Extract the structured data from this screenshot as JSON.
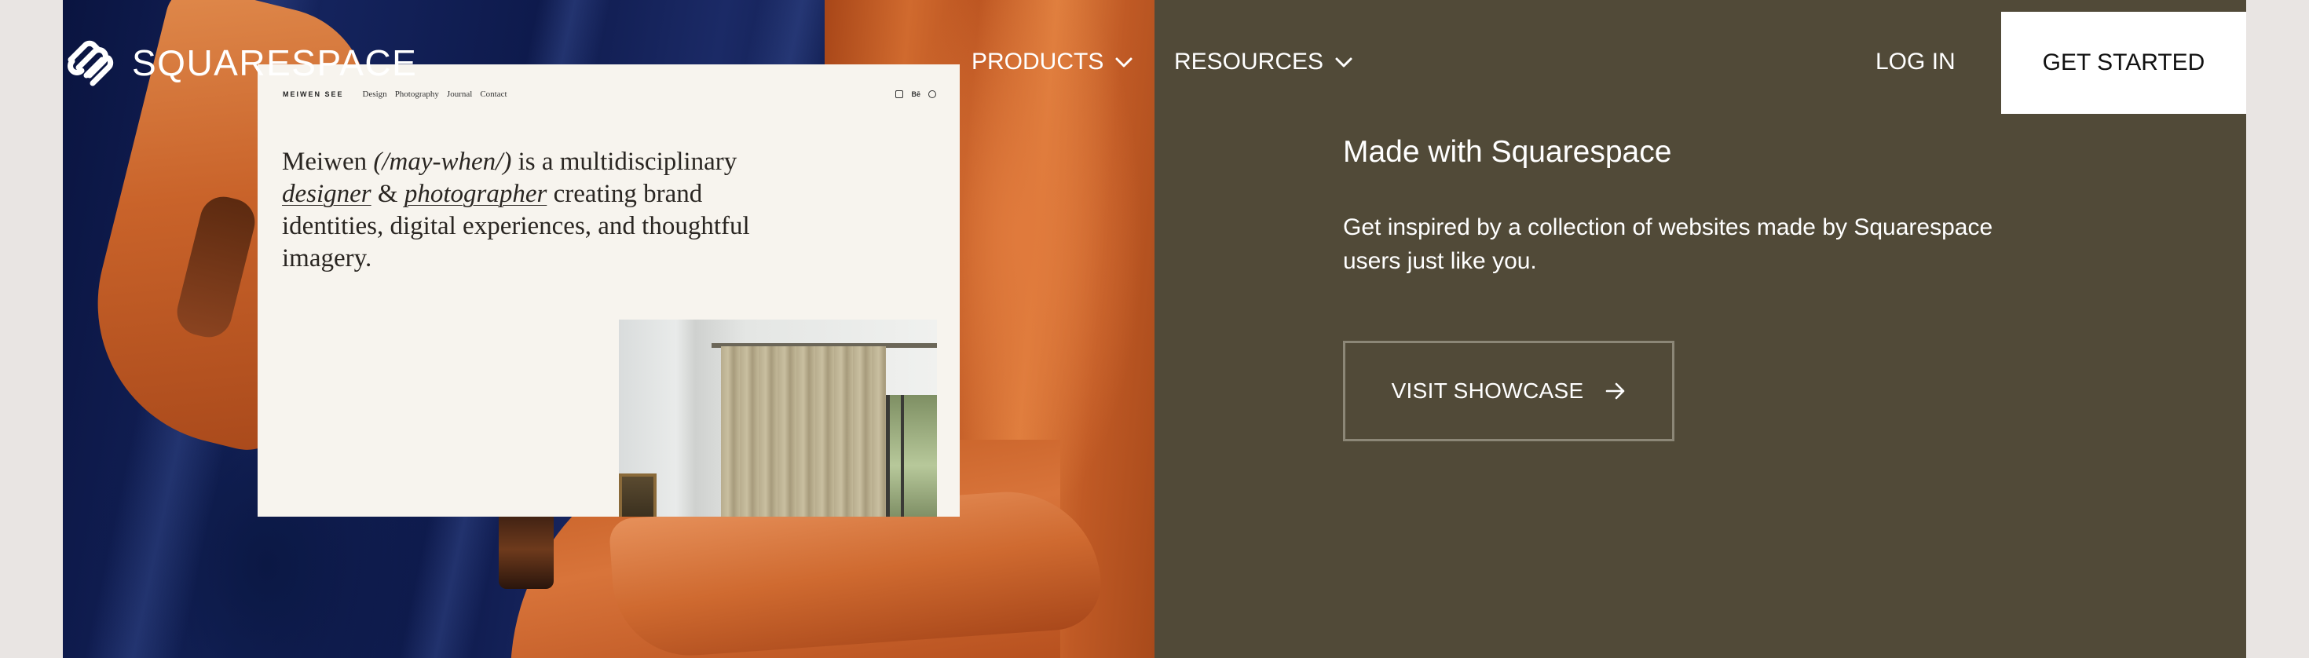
{
  "header": {
    "brand": "SQUARESPACE",
    "nav": [
      {
        "label": "PRODUCTS"
      },
      {
        "label": "RESOURCES"
      }
    ],
    "login_label": "LOG IN",
    "cta_label": "GET STARTED"
  },
  "preview": {
    "site_name": "MEIWEN SEE",
    "links": [
      "Design",
      "Photography",
      "Journal",
      "Contact"
    ],
    "icons": [
      "instagram-icon",
      "behance-icon",
      "pinterest-icon"
    ],
    "intro_name": "Meiwen",
    "intro_pron": "(/may-when/)",
    "intro_1": "is a multidisciplinary",
    "intro_role_1": "designer",
    "intro_amp": "&",
    "intro_role_2": "photographer",
    "intro_2": "creating brand identities, digital experiences, and thoughtful imagery."
  },
  "panel": {
    "title": "Made with Squarespace",
    "description": "Get inspired by a collection of websites made by Squarespace users just like you.",
    "button_label": "VISIT SHOWCASE"
  },
  "colors": {
    "panel_bg": "#514a38",
    "preview_bg": "#f7f4ee",
    "page_bg": "#e9e5e3",
    "button_border": "#8c8777"
  }
}
